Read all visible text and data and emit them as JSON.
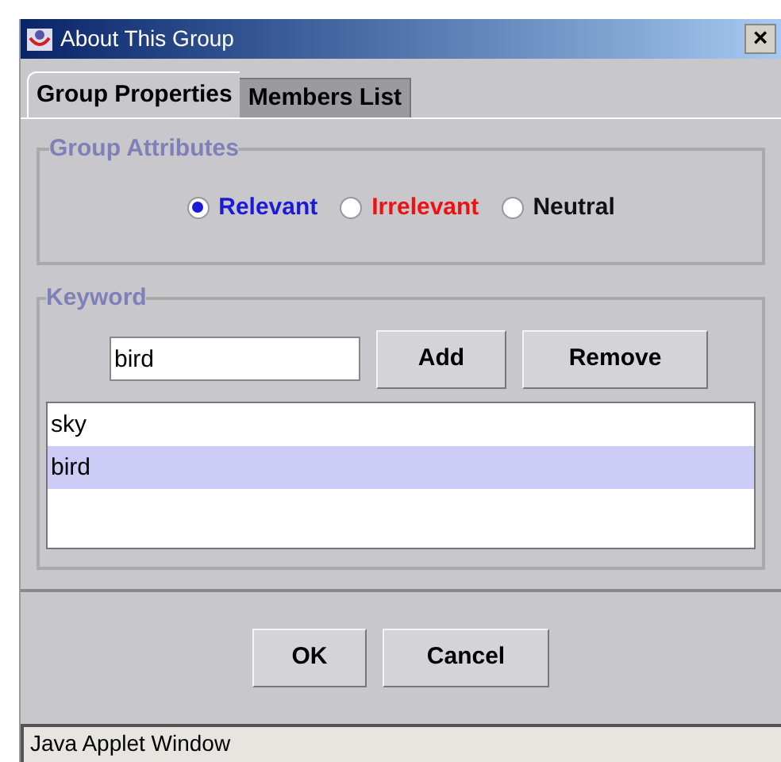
{
  "window": {
    "title": "About This Group",
    "close": "×"
  },
  "tabs": [
    {
      "label": "Group Properties",
      "selected": true
    },
    {
      "label": "Members List",
      "selected": false
    }
  ],
  "group_attributes": {
    "title": "Group Attributes",
    "options": [
      {
        "label": "Relevant",
        "selected": true,
        "color": "#1a1ad8"
      },
      {
        "label": "Irrelevant",
        "selected": false,
        "color": "#ee1111"
      },
      {
        "label": "Neutral",
        "selected": false,
        "color": "#111111"
      }
    ]
  },
  "keyword": {
    "title": "Keyword",
    "value": "bird",
    "buttons": [
      "Add",
      "Remove"
    ],
    "items": [
      {
        "label": "sky",
        "selected": false
      },
      {
        "label": "bird",
        "selected": true
      }
    ]
  },
  "buttons": [
    "OK",
    "Cancel"
  ],
  "status_bar": "Java Applet Window"
}
